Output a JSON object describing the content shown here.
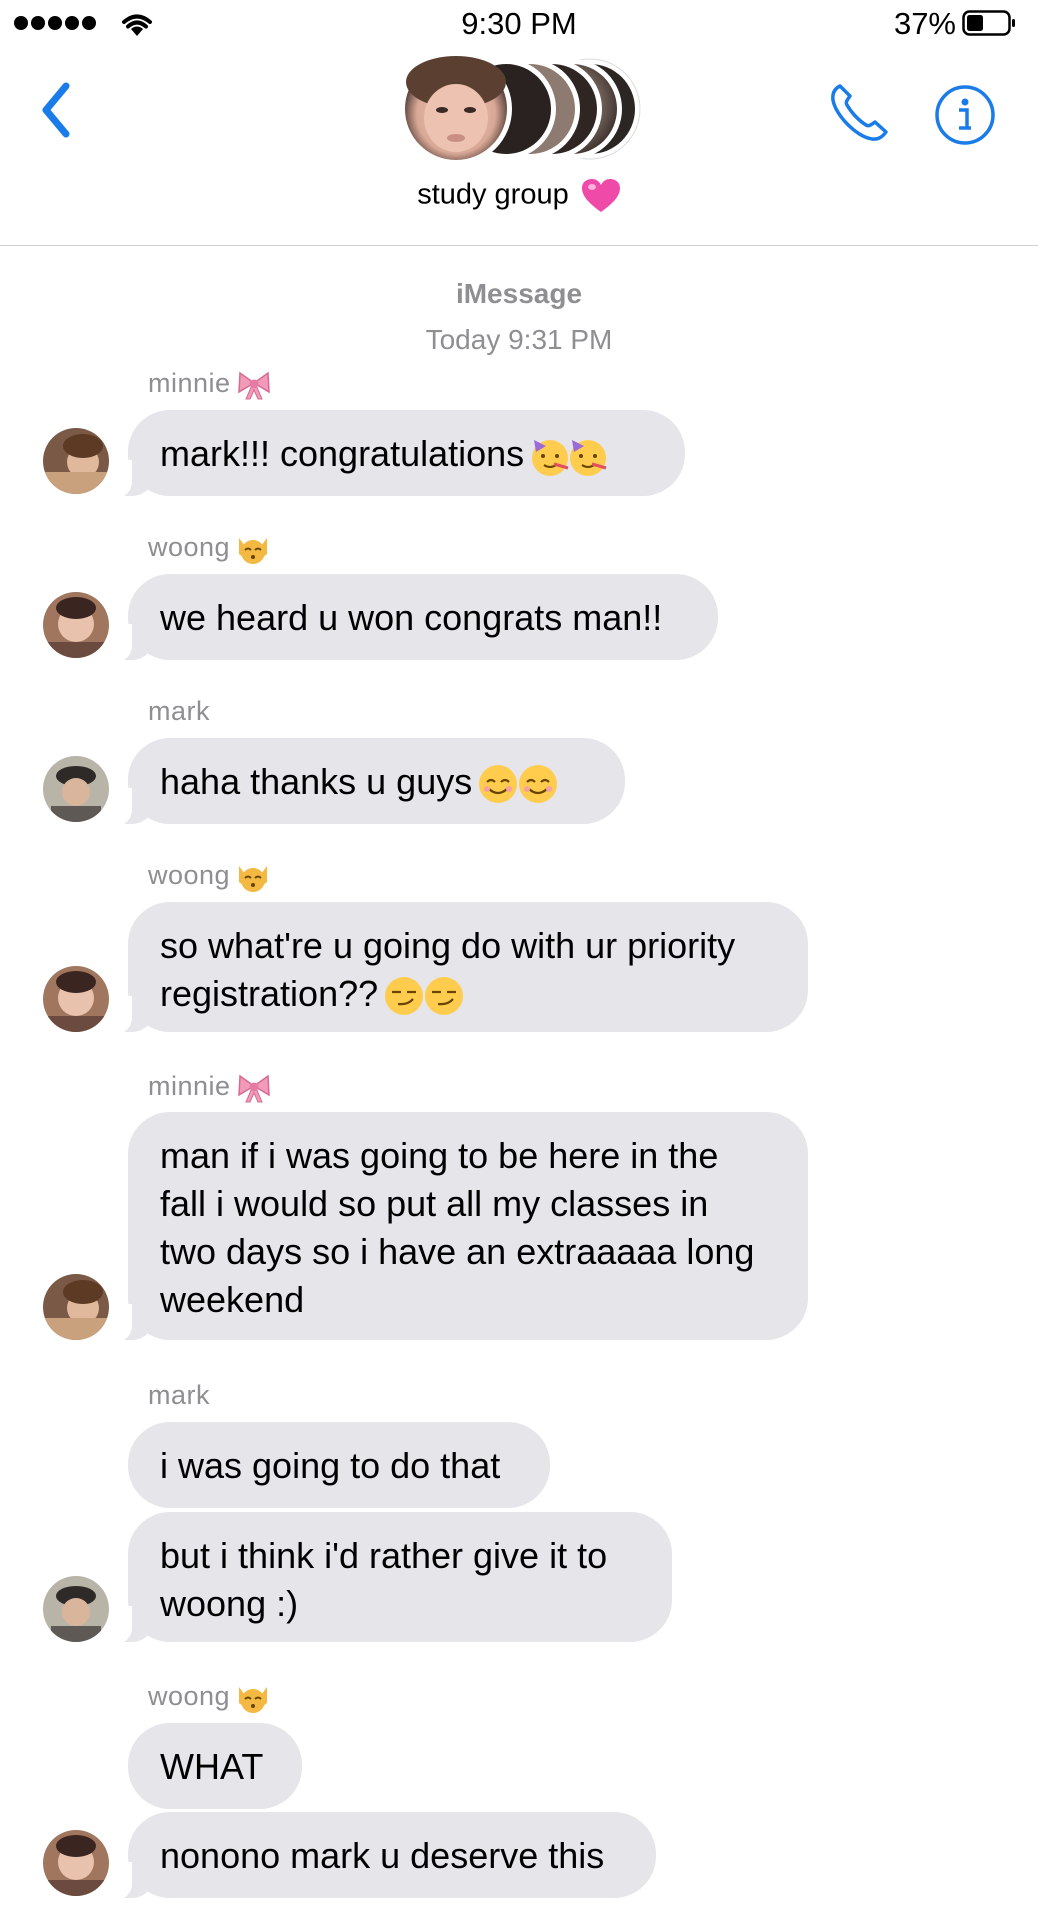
{
  "status_bar": {
    "time": "9:30 PM",
    "battery": "37%"
  },
  "header": {
    "group_name": "study group"
  },
  "thread": {
    "service": "iMessage",
    "date_label": "Today",
    "time_label": "9:31 PM"
  },
  "senders": {
    "minnie": "minnie",
    "woong": "woong",
    "mark": "mark"
  },
  "messages": [
    {
      "sender": "minnie",
      "text": "mark!!! congratulations",
      "emoji": "partying-face"
    },
    {
      "sender": "woong",
      "text": "we heard u won congrats man!!"
    },
    {
      "sender": "mark",
      "text": "haha thanks u guys",
      "emoji": "smiling-face"
    },
    {
      "sender": "woong",
      "text_lines": [
        "so what're u going do with ur priority",
        "registration??"
      ],
      "emoji": "smirking-face"
    },
    {
      "sender": "minnie",
      "text_lines": [
        "man if i was going to be here in the",
        "fall i would so put all my classes in",
        "two days so i have an extraaaaa long",
        "weekend"
      ]
    },
    {
      "sender": "mark",
      "text": "i was going to do that"
    },
    {
      "sender": "mark",
      "text_lines": [
        "but i think i'd rather give it to",
        "woong :)"
      ]
    },
    {
      "sender": "woong",
      "text": "WHAT"
    },
    {
      "sender": "woong",
      "text": "nonono mark u deserve this"
    }
  ],
  "colors": {
    "accent": "#1a7ce8",
    "bubble": "#e5e5ea",
    "meta": "#8e8e93"
  },
  "icons": [
    "back-chevron-icon",
    "phone-icon",
    "info-icon",
    "wifi-icon",
    "battery-icon",
    "ribbon-icon",
    "kissing-cat-icon"
  ]
}
